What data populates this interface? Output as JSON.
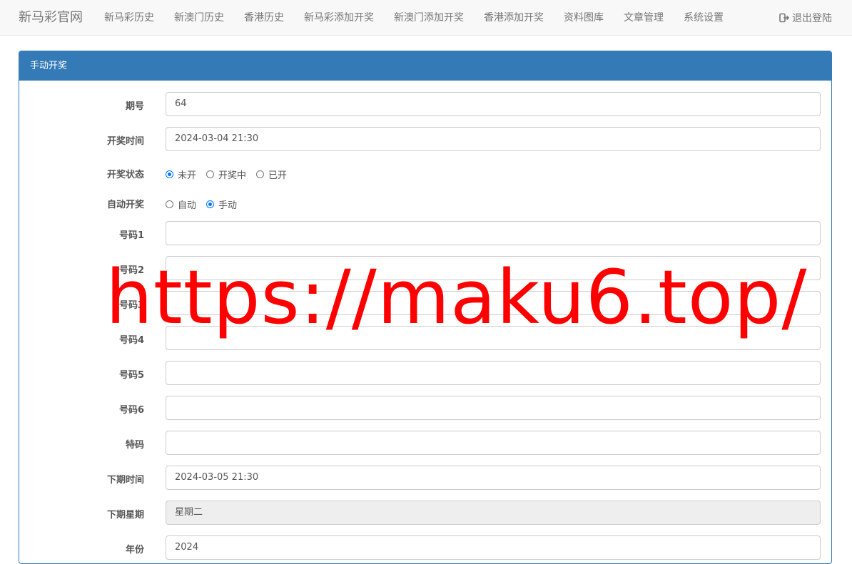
{
  "brand": "新马彩官网",
  "nav": [
    "新马彩历史",
    "新澳门历史",
    "香港历史",
    "新马彩添加开奖",
    "新澳门添加开奖",
    "香港添加开奖",
    "资料图库",
    "文章管理",
    "系统设置"
  ],
  "logout": {
    "label": "退出登陆",
    "icon": "sign-out-icon"
  },
  "panel": {
    "title": "手动开奖"
  },
  "form": {
    "issue": {
      "label": "期号",
      "value": "64"
    },
    "draw_time": {
      "label": "开奖时间",
      "value": "2024-03-04 21:30"
    },
    "draw_status": {
      "label": "开奖状态",
      "options": [
        "未开",
        "开奖中",
        "已开"
      ],
      "selected": "未开"
    },
    "auto_draw": {
      "label": "自动开奖",
      "options": [
        "自动",
        "手动"
      ],
      "selected": "手动"
    },
    "numbers": [
      {
        "label": "号码1",
        "value": ""
      },
      {
        "label": "号码2",
        "value": ""
      },
      {
        "label": "号码3",
        "value": ""
      },
      {
        "label": "号码4",
        "value": ""
      },
      {
        "label": "号码5",
        "value": ""
      },
      {
        "label": "号码6",
        "value": ""
      }
    ],
    "special": {
      "label": "特码",
      "value": ""
    },
    "next_time": {
      "label": "下期时间",
      "value": "2024-03-05 21:30"
    },
    "next_weekday": {
      "label": "下期星期",
      "value": "星期二"
    },
    "year": {
      "label": "年份",
      "value": "2024"
    }
  },
  "watermark": "https://maku6.top/",
  "colors": {
    "primary": "#337ab7",
    "watermark": "#ff0000",
    "radio_checked": "#0075ff"
  }
}
